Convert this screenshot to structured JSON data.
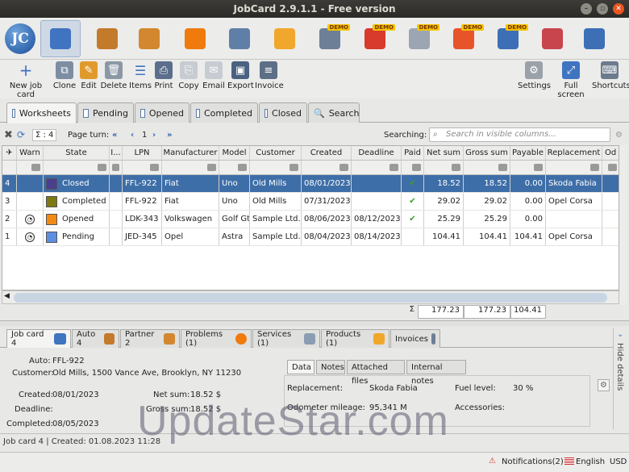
{
  "window": {
    "title": "JobCard 2.9.1.1 - Free version"
  },
  "brand": {
    "logo_text": "JC"
  },
  "nav_icons": [
    {
      "name": "worksheets-icon",
      "color": "#3f74c0",
      "demo": false
    },
    {
      "name": "car-icon",
      "color": "#c47a2b",
      "demo": false
    },
    {
      "name": "partner-icon",
      "color": "#d3882f",
      "demo": false
    },
    {
      "name": "problem-icon",
      "color": "#f07a0c",
      "demo": false
    },
    {
      "name": "tools-icon",
      "color": "#5f7fa7",
      "demo": false
    },
    {
      "name": "box-icon",
      "color": "#f0a72c",
      "demo": false
    },
    {
      "name": "document-icon",
      "color": "#6d7f96",
      "demo": true
    },
    {
      "name": "clock-icon",
      "color": "#d83a2b",
      "demo": true
    },
    {
      "name": "envelope-icon",
      "color": "#9ba6b2",
      "demo": true
    },
    {
      "name": "pie-chart-icon",
      "color": "#e8542a",
      "demo": true
    },
    {
      "name": "robot-icon",
      "color": "#3d6fb6",
      "demo": true
    },
    {
      "name": "grid-icon",
      "color": "#c8454e",
      "demo": false
    },
    {
      "name": "diamond-icon",
      "color": "#3d6fb6",
      "demo": false
    }
  ],
  "demo_label": "DEMO",
  "toolbar": {
    "new_job_card": "New job card",
    "clone": "Clone",
    "edit": "Edit",
    "delete": "Delete",
    "items": "Items",
    "print": "Print",
    "copy": "Copy",
    "email": "Email",
    "export": "Export",
    "invoice": "Invoice",
    "settings": "Settings",
    "fullscreen": "Full screen",
    "shortcuts": "Shortcuts"
  },
  "main_tabs": [
    "Worksheets",
    "Pending",
    "Opened",
    "Completed",
    "Closed",
    "Search"
  ],
  "filterbar": {
    "sigma": "Σ : 4",
    "page_turn": "Page turn:",
    "page": "1",
    "searching": "Searching:",
    "search_placeholder": "Search in visible columns..."
  },
  "table": {
    "columns": [
      "Warn",
      "State",
      "I...",
      "LPN",
      "Manufacturer",
      "Model",
      "Customer",
      "Created",
      "Deadline",
      "Paid",
      "Net sum",
      "Gross sum",
      "Payable",
      "Replacement",
      "Od"
    ],
    "rows": [
      {
        "id": "4",
        "warn": false,
        "state": "Closed",
        "color": "#4a3e8f",
        "lpn": "FFL-922",
        "manufacturer": "Fiat",
        "model": "Uno",
        "customer": "Old Mills",
        "created": "08/01/2023",
        "deadline": "",
        "paid": true,
        "net": "18.52",
        "gross": "18.52",
        "payable": "0.00",
        "replacement": "Skoda Fabia",
        "selected": true
      },
      {
        "id": "3",
        "warn": false,
        "state": "Completed",
        "color": "#7d7a14",
        "lpn": "FFL-922",
        "manufacturer": "Fiat",
        "model": "Uno",
        "customer": "Old Mills",
        "created": "07/31/2023",
        "deadline": "",
        "paid": true,
        "net": "29.02",
        "gross": "29.02",
        "payable": "0.00",
        "replacement": "Opel Corsa",
        "selected": false
      },
      {
        "id": "2",
        "warn": true,
        "state": "Opened",
        "color": "#f28a12",
        "lpn": "LDK-343",
        "manufacturer": "Volkswagen",
        "model": "Golf Gt",
        "customer": "Sample Ltd.",
        "created": "08/06/2023",
        "deadline": "08/12/2023",
        "paid": true,
        "net": "25.29",
        "gross": "25.29",
        "payable": "0.00",
        "replacement": "",
        "selected": false
      },
      {
        "id": "1",
        "warn": true,
        "state": "Pending",
        "color": "#5e8ee0",
        "lpn": "JED-345",
        "manufacturer": "Opel",
        "model": "Astra",
        "customer": "Sample Ltd.",
        "created": "08/04/2023",
        "deadline": "08/14/2023",
        "paid": false,
        "net": "104.41",
        "gross": "104.41",
        "payable": "104.41",
        "replacement": "Opel Corsa",
        "selected": false
      }
    ],
    "totals": {
      "sigma": "Σ",
      "net": "177.23",
      "gross": "177.23",
      "payable": "104.41"
    }
  },
  "detail_tabs": [
    "Job card 4",
    "Auto 4",
    "Partner 2",
    "Problems (1)",
    "Services (1)",
    "Products (1)",
    "Invoices"
  ],
  "details": {
    "auto_label": "Auto:",
    "auto_value": "FFL-922",
    "customer_label": "Customer:",
    "customer_value": "Old Mills, 1500 Vance Ave, Brooklyn, NY 11230",
    "created_label": "Created:",
    "created_value": "08/01/2023",
    "deadline_label": "Deadline:",
    "completed_label": "Completed:",
    "completed_value": "08/05/2023",
    "net_label": "Net sum:",
    "net_value": "18.52 $",
    "gross_label": "Gross sum:",
    "gross_value": "18.52 $",
    "subtabs": [
      "Data",
      "Notes",
      "Attached files",
      "Internal notes"
    ],
    "replacement_label": "Replacement:",
    "replacement_value": "Skoda Fabia",
    "odometer_label": "Odometer mileage:",
    "odometer_value": "95,341 M",
    "fuel_label": "Fuel level:",
    "fuel_value": "30 %",
    "accessories_label": "Accessories:",
    "hide_details": "Hide details"
  },
  "status": {
    "text": "Job card 4 | Created: 01.08.2023 11:28"
  },
  "footer": {
    "notifications": "Notifications(2)",
    "language": "English",
    "currency": "USD"
  },
  "watermark": "UpdateStar.com"
}
